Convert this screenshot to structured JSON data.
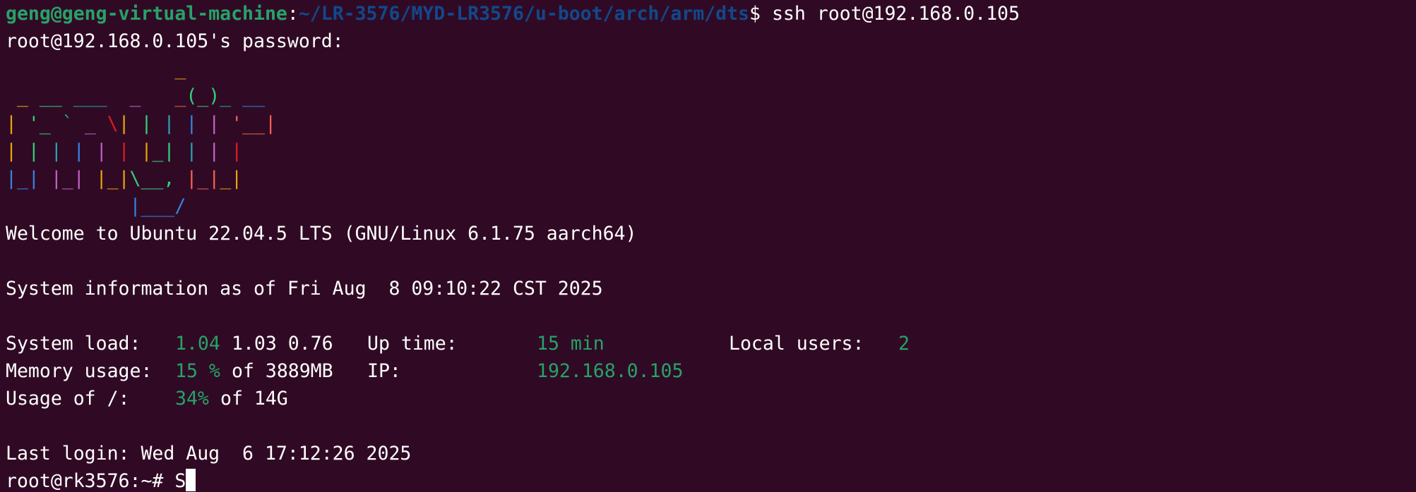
{
  "prompt": {
    "user_host": "geng@geng-virtual-machine",
    "separator": ":",
    "path": "~/LR-3576/MYD-LR3576/u-boot/arch/arm/dts",
    "symbol": "$",
    "command": " ssh root@192.168.0.105"
  },
  "password_prompt": "root@192.168.0.105's password:",
  "banner": {
    "line1": "               _",
    "line2": " _ __ ___  _   _(_)_ __",
    "line3": "| '_ ` _ \\| | | | | '__|",
    "line4": "| | | | | | |_| | | |",
    "line5": "|_| |_| |_|\\__, |_|_|",
    "line6": "           |___/"
  },
  "welcome": "Welcome to Ubuntu 22.04.5 LTS (GNU/Linux 6.1.75 aarch64)",
  "sysinfo_header": "System information as of Fri Aug  8 09:10:22 CST 2025",
  "stats": {
    "load_label": "System load:",
    "load_1": "1.04",
    "load_rest": "1.03 0.76",
    "uptime_label": "Up time:",
    "uptime_value": "15 min",
    "users_label": "Local users:",
    "users_value": "2",
    "mem_label": "Memory usage:",
    "mem_value": "15 %",
    "mem_rest": "of 3889MB",
    "ip_label": "IP:",
    "ip_value": "192.168.0.105",
    "disk_label": "Usage of /:",
    "disk_value": "34%",
    "disk_rest": "of 14G"
  },
  "last_login": "Last login: Wed Aug  6 17:12:26 2025",
  "remote_prompt": "root@rk3576:~#",
  "remote_input": "S"
}
